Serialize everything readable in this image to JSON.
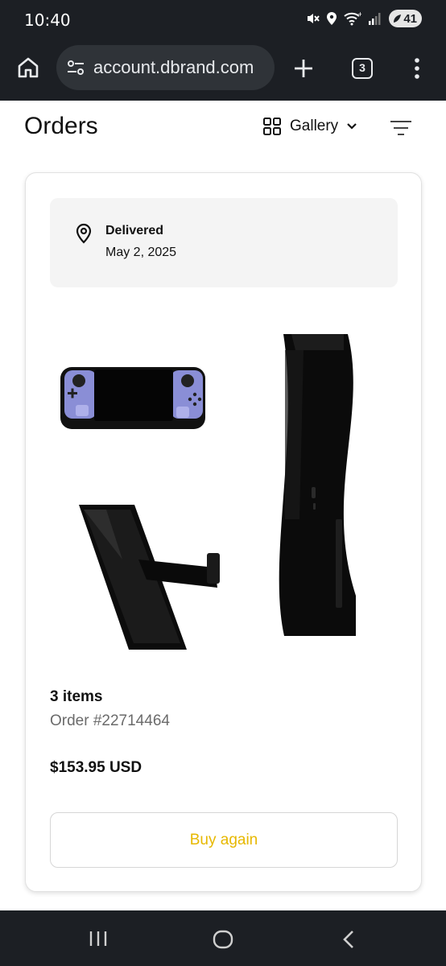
{
  "status_bar": {
    "time": "10:40",
    "battery_level": "41",
    "icons": [
      "mute-icon",
      "location-icon",
      "wifi-icon",
      "signal-icon",
      "battery-icon"
    ]
  },
  "browser": {
    "url": "account.dbrand.com",
    "tab_count": "3",
    "icons": [
      "home-icon",
      "site-settings-icon",
      "new-tab-icon",
      "tab-switcher-icon",
      "overflow-menu-icon"
    ]
  },
  "page": {
    "title": "Orders",
    "view_selector": "Gallery"
  },
  "order": {
    "status": "Delivered",
    "date": "May 2, 2025",
    "item_count": "3 items",
    "order_number": "Order #22714464",
    "total": "$153.95 USD",
    "buy_again_label": "Buy again",
    "products": [
      "handheld-console-skin",
      "phone-case-with-stand",
      "console-cover-plates"
    ]
  },
  "colors": {
    "system_bar": "#1c1f24",
    "accent": "#e7b800",
    "status_box": "#f4f4f4",
    "muted_text": "#6b6b6b",
    "handheld_skin": "#8a8ed6"
  }
}
